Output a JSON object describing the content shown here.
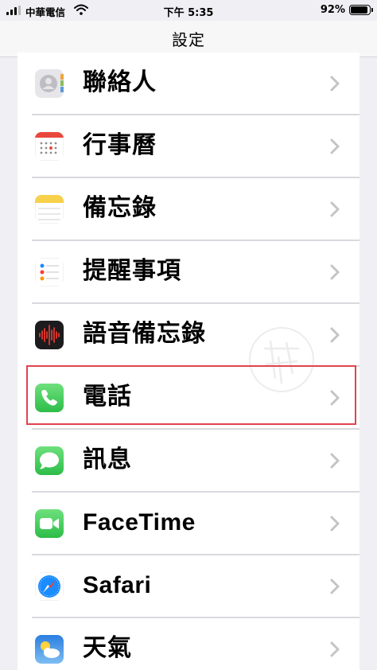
{
  "status_bar": {
    "carrier": "中華電信",
    "time": "下午 5:35",
    "battery_percent": "92%",
    "battery_level": 0.92,
    "signal_bars": 3,
    "wifi_icon": "wifi-icon"
  },
  "nav": {
    "title": "設定"
  },
  "settings_items": [
    {
      "label": "聯絡人",
      "icon": "contacts-icon"
    },
    {
      "label": "行事曆",
      "icon": "calendar-icon"
    },
    {
      "label": "備忘錄",
      "icon": "notes-icon"
    },
    {
      "label": "提醒事項",
      "icon": "reminders-icon"
    },
    {
      "label": "語音備忘錄",
      "icon": "voice-memos-icon"
    },
    {
      "label": "電話",
      "icon": "phone-icon",
      "highlighted": true
    },
    {
      "label": "訊息",
      "icon": "messages-icon"
    },
    {
      "label": "FaceTime",
      "icon": "facetime-icon"
    },
    {
      "label": "Safari",
      "icon": "safari-icon"
    },
    {
      "label": "天氣",
      "icon": "weather-icon"
    }
  ],
  "colors": {
    "highlight_border": "#e0444f",
    "ios_green": "#35c759",
    "ios_blue": "#1a8cff"
  }
}
